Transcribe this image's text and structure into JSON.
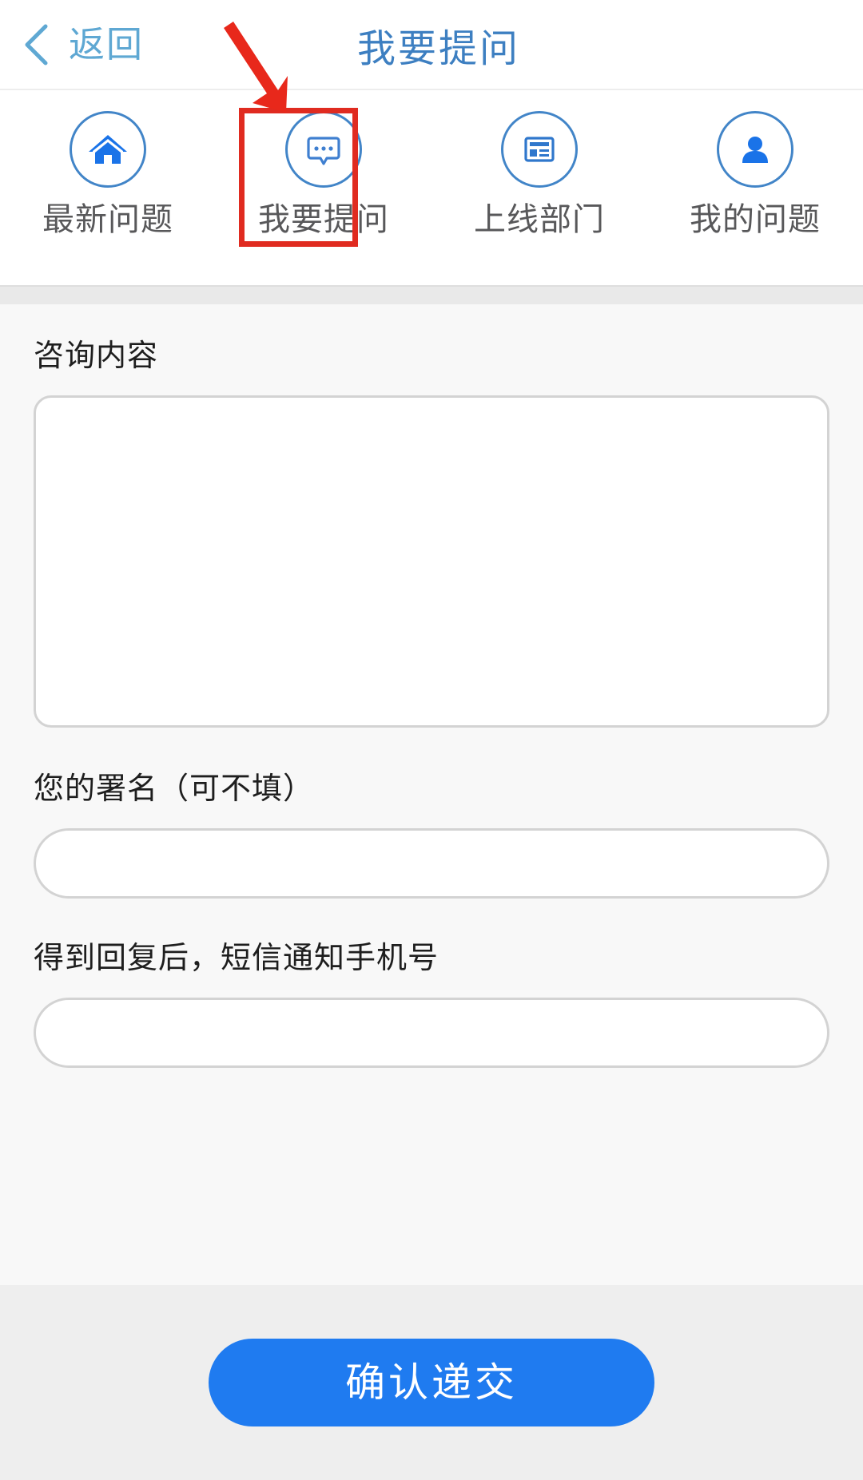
{
  "header": {
    "back_label": "返回",
    "title": "我要提问",
    "back_icon": "chevron-left-icon",
    "title_color": "#3d7fc1",
    "back_color": "#5fa8d3"
  },
  "tabs": [
    {
      "label": "最新问题",
      "icon": "home-icon",
      "active": false
    },
    {
      "label": "我要提问",
      "icon": "chat-bubble-icon",
      "active": true
    },
    {
      "label": "上线部门",
      "icon": "newspaper-icon",
      "active": false
    },
    {
      "label": "我的问题",
      "icon": "user-icon",
      "active": false
    }
  ],
  "annotation": {
    "highlight_color": "#e02b20",
    "arrow_icon": "red-arrow-down-right-icon",
    "target_tab": "我要提问"
  },
  "form": {
    "content": {
      "label": "咨询内容",
      "value": "",
      "placeholder": ""
    },
    "signature": {
      "label": "您的署名（可不填）",
      "value": "",
      "placeholder": ""
    },
    "phone": {
      "label": "得到回复后，短信通知手机号",
      "value": "",
      "placeholder": ""
    }
  },
  "footer": {
    "submit_label": "确认递交",
    "submit_color": "#1f7bf0"
  }
}
